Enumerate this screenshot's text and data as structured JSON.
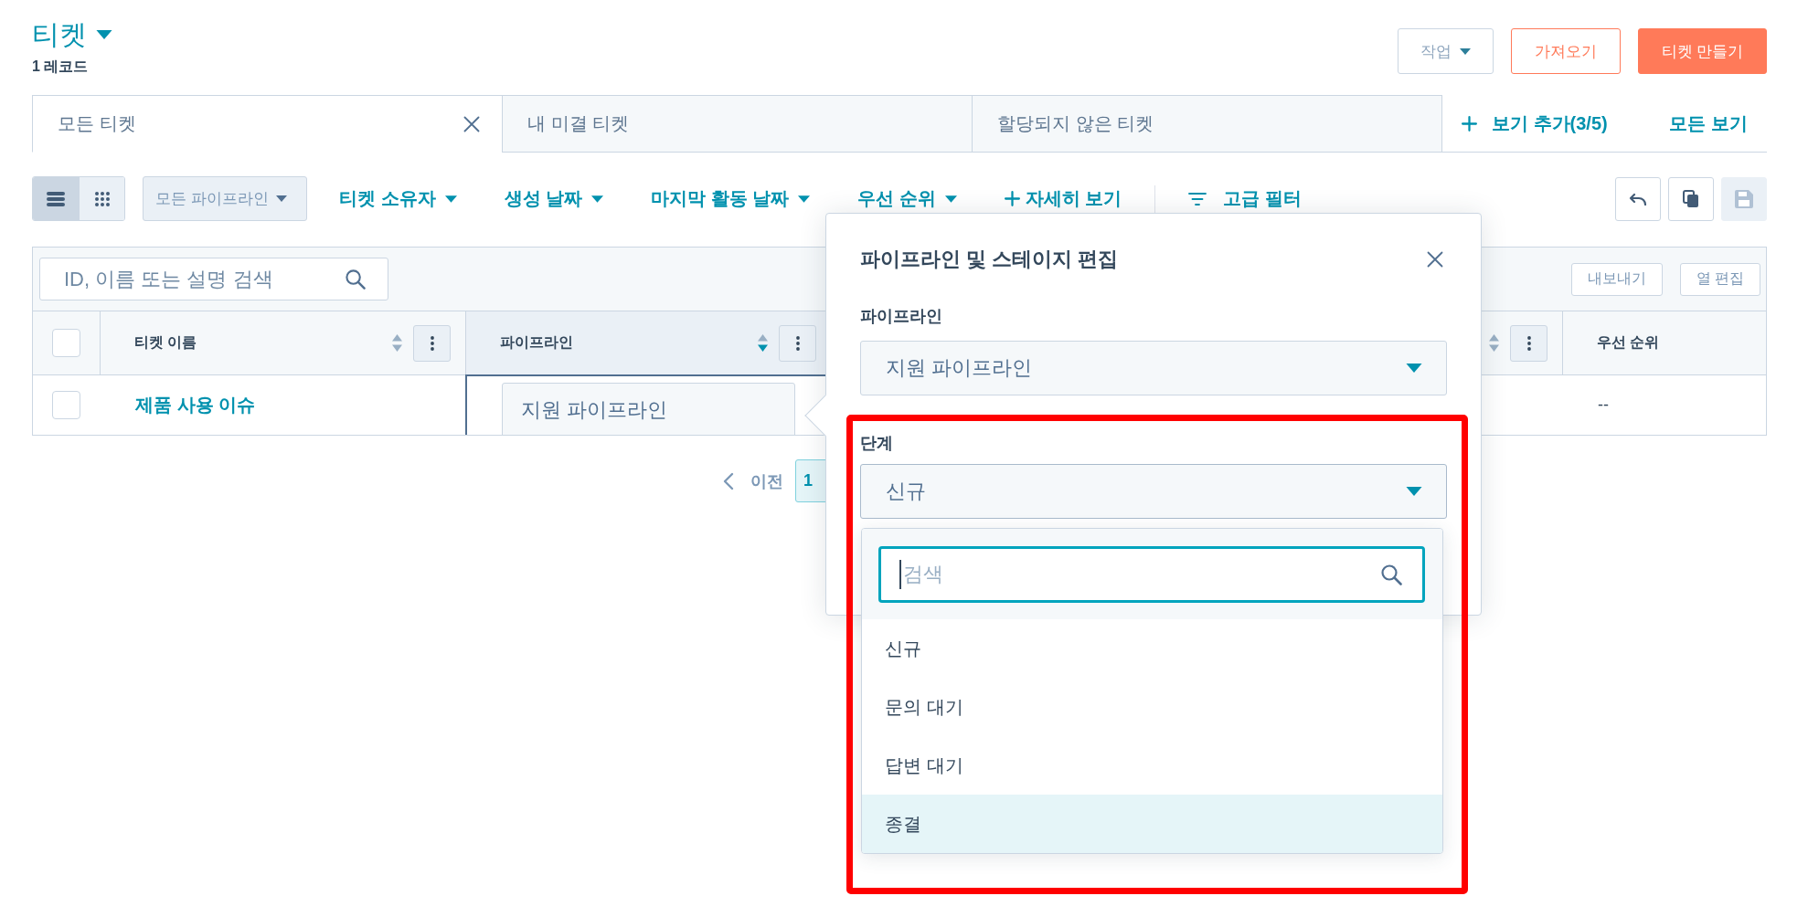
{
  "header": {
    "title": "티켓",
    "record_count": "1 레코드",
    "buttons": [
      {
        "label": "작업",
        "kind": "menu"
      },
      {
        "label": "가져오기",
        "kind": "secondary"
      },
      {
        "label": "티켓 만들기",
        "kind": "primary"
      }
    ]
  },
  "view_tabs": [
    {
      "label": "모든 티켓",
      "selected": true,
      "closable": true
    },
    {
      "label": "내 미결 티켓",
      "selected": false,
      "closable": false
    },
    {
      "label": "할당되지 않은 티켓",
      "selected": false,
      "closable": false
    }
  ],
  "view_links": [
    {
      "label": "보기 추가(3/5)",
      "kind": "add"
    },
    {
      "label": "모든 보기",
      "kind": "link"
    }
  ],
  "toolbar": {
    "view_modes": [
      {
        "kind": "list",
        "selected": true
      },
      {
        "kind": "grid",
        "selected": false
      }
    ],
    "pipeline_filter": "모든 파이프라인",
    "filters": [
      {
        "label": "티켓 소유자",
        "kind": "dropdown"
      },
      {
        "label": "생성 날짜",
        "kind": "dropdown"
      },
      {
        "label": "마지막 활동 날짜",
        "kind": "dropdown"
      },
      {
        "label": "우선 순위",
        "kind": "dropdown"
      },
      {
        "label": "자세히 보기",
        "kind": "add"
      },
      {
        "label": "고급 필터",
        "kind": "advanced"
      }
    ],
    "actions": [
      {
        "kind": "undo",
        "disabled": false
      },
      {
        "kind": "copy",
        "disabled": false
      },
      {
        "kind": "save",
        "disabled": true
      }
    ]
  },
  "table": {
    "search": {
      "placeholder": "ID, 이름 또는 설명 검색"
    },
    "buttons": [
      "내보내기",
      "열 편집"
    ],
    "select_all": {
      "checked": false
    },
    "columns": [
      {
        "label": "티켓 이름",
        "sorted": false
      },
      {
        "label": "파이프라인",
        "sorted": true
      },
      {
        "sorted": false
      },
      {
        "label": "우선 순위"
      }
    ],
    "rows": [
      {
        "checked": false,
        "ticket_name": "제품 사용 이슈",
        "pipeline": {
          "value": "지원 파이프라인",
          "editing": true
        },
        "priority": "--"
      }
    ]
  },
  "pagination": {
    "previous": "이전",
    "pages": [
      {
        "label": "1",
        "selected": true
      }
    ]
  },
  "popup": {
    "title": "파이프라인 및 스테이지 편집",
    "fields": [
      {
        "label": "파이프라인",
        "value": "지원 파이프라인",
        "expanded": false
      },
      {
        "label": "단계",
        "value": "신규",
        "expanded": true,
        "menu": {
          "search": {
            "placeholder": "검색",
            "focused": true
          },
          "options": [
            {
              "label": "신규",
              "highlighted": false
            },
            {
              "label": "문의 대기",
              "highlighted": false
            },
            {
              "label": "답변 대기",
              "highlighted": false
            },
            {
              "label": "종결",
              "highlighted": true
            }
          ]
        }
      }
    ]
  }
}
